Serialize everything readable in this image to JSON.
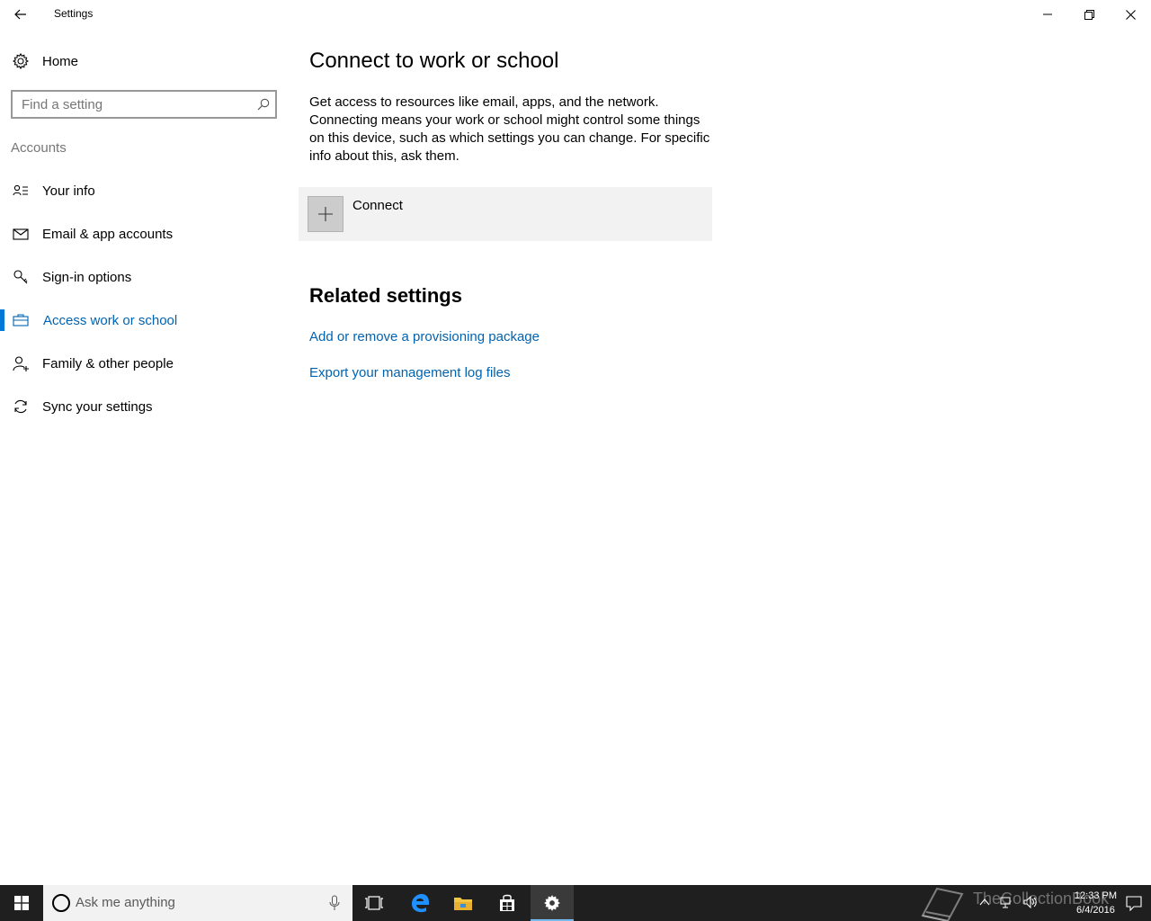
{
  "window": {
    "title": "Settings"
  },
  "sidebar": {
    "home_label": "Home",
    "search_placeholder": "Find a setting",
    "section_label": "Accounts",
    "items": [
      {
        "label": "Your info",
        "icon": "contact-info-icon"
      },
      {
        "label": "Email & app accounts",
        "icon": "mail-icon"
      },
      {
        "label": "Sign-in options",
        "icon": "key-icon"
      },
      {
        "label": "Access work or school",
        "icon": "briefcase-icon",
        "active": true
      },
      {
        "label": "Family & other people",
        "icon": "add-person-icon"
      },
      {
        "label": "Sync your settings",
        "icon": "sync-icon"
      }
    ]
  },
  "main": {
    "title": "Connect to work or school",
    "description": "Get access to resources like email, apps, and the network. Connecting means your work or school might control some things on this device, such as which settings you can change. For specific info about this, ask them.",
    "connect_label": "Connect",
    "related_title": "Related settings",
    "links": [
      "Add or remove a provisioning package",
      "Export your management log files"
    ]
  },
  "taskbar": {
    "search_placeholder": "Ask me anything",
    "watermark": "TheCollectionBook",
    "time": "12:33 PM",
    "date": "6/4/2016"
  },
  "colors": {
    "accent": "#0078d7",
    "link": "#0063b1",
    "taskbar": "#1f1f1f"
  }
}
